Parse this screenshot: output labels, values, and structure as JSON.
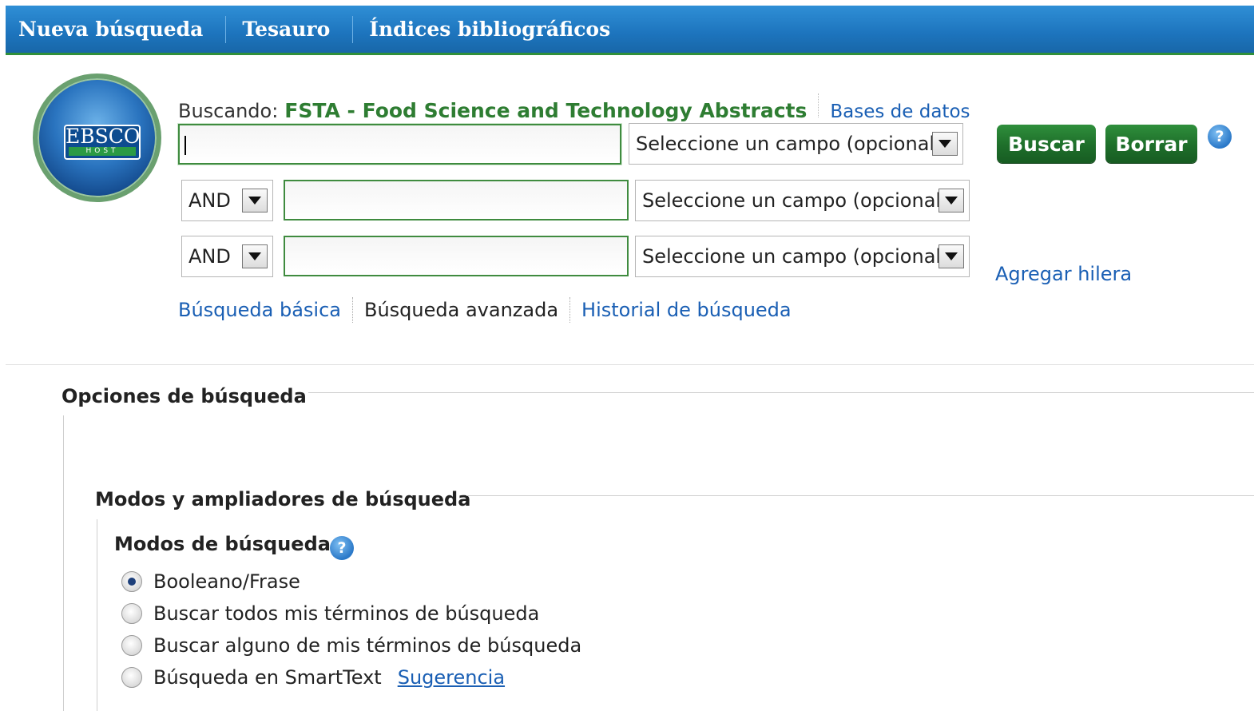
{
  "nav": {
    "items": [
      "Nueva búsqueda",
      "Tesauro",
      "Índices bibliográficos"
    ]
  },
  "logo": {
    "text": "EBSCO",
    "subtext": "HOST"
  },
  "search": {
    "searching_label": "Buscando:",
    "database_name": "FSTA - Food Science and Technology Abstracts",
    "databases_link": "Bases de datos",
    "rows": [
      {
        "operator": "",
        "value": "",
        "field": "Seleccione un campo (opcional"
      },
      {
        "operator": "AND",
        "value": "",
        "field": "Seleccione un campo (opcional"
      },
      {
        "operator": "AND",
        "value": "",
        "field": "Seleccione un campo (opcional"
      }
    ],
    "search_button": "Buscar",
    "clear_button": "Borrar",
    "help_glyph": "?",
    "add_row_link": "Agregar hilera"
  },
  "search_tabs": {
    "basic": "Búsqueda básica",
    "advanced": "Búsqueda avanzada",
    "history": "Historial de búsqueda"
  },
  "options": {
    "title": "Opciones de búsqueda",
    "modes_section_title": "Modos y ampliadores de búsqueda",
    "modes_title": "Modos de búsqueda",
    "modes": [
      {
        "label": "Booleano/Frase",
        "selected": true
      },
      {
        "label": "Buscar todos mis términos de búsqueda",
        "selected": false
      },
      {
        "label": "Buscar alguno de mis términos de búsqueda",
        "selected": false
      },
      {
        "label": "Búsqueda en SmartText",
        "selected": false
      }
    ],
    "suggestion_link": "Sugerencia"
  },
  "colors": {
    "nav_blue": "#1d74bd",
    "brand_green": "#2e7d32",
    "link_blue": "#1a5fb4"
  }
}
